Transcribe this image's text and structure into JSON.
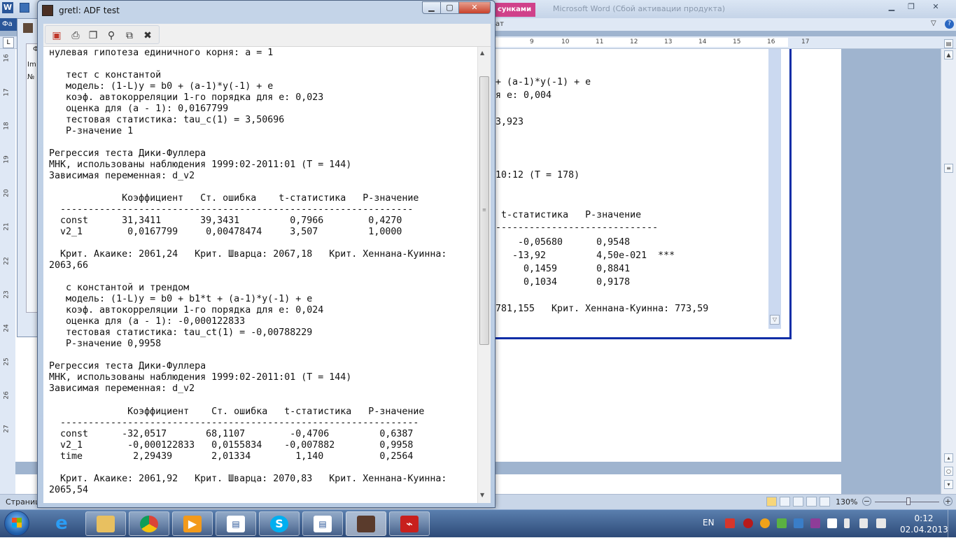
{
  "word": {
    "title_suffix": "Microsoft Word (Сбой активации продукта)",
    "pink_tab": "сунками",
    "file_tab": "Фа",
    "ribbon_label": "ат",
    "ruler_numbers": [
      "9",
      "10",
      "11",
      "12",
      "13",
      "14",
      "15",
      "16",
      "17"
    ],
    "vruler_numbers": [
      "16",
      "17",
      "18",
      "19",
      "20",
      "21",
      "22",
      "23",
      "24",
      "25",
      "26",
      "27"
    ],
    "embedded_lines": [
      "+ (a-1)*y(-1) + e",
      "я е: 0,004",
      "3,923",
      "10:12 (T = 178)",
      " t-статистика   P-значение",
      "-----------------------------",
      "    -0,05680      0,9548",
      "   -13,92         4,50e-021  ***",
      "     0,1459       0,8841",
      "     0,1034       0,9178",
      "781,155   Крит. Хеннана-Куинна: 773,59"
    ],
    "status_page": "Страниц",
    "zoom": "130%"
  },
  "behind": {
    "label1": "Фа",
    "label2": "Im",
    "label3": "№"
  },
  "gretl": {
    "title": "gretl: ADF test",
    "toolbar": {
      "save": "save-icon",
      "print": "print-icon",
      "copy": "copy-icon",
      "find": "find-icon",
      "windows": "windows-icon",
      "close": "close-icon"
    },
    "output": "нулевая гипотеза единичного корня: a = 1\n\n   тест с константой\n   модель: (1-L)y = b0 + (a-1)*y(-1) + e\n   коэф. автокорреляции 1-го порядка для е: 0,023\n   оценка для (a - 1): 0,0167799\n   тестовая статистика: tau_c(1) = 3,50696\n   P-значение 1\n\nРегрессия теста Дики-Фуллера\nМНК, использованы наблюдения 1999:02-2011:01 (T = 144)\nЗависимая переменная: d_v2\n\n             Коэффициент   Ст. ошибка    t-статистика   P-значение\n  ---------------------------------------------------------------\n  const      31,3411       39,3431         0,7966        0,4270\n  v2_1        0,0167799     0,00478474     3,507         1,0000\n\n  Крит. Акаике: 2061,24   Крит. Шварца: 2067,18   Крит. Хеннана-Куинна:\n2063,66\n\n   с константой и трендом\n   модель: (1-L)y = b0 + b1*t + (a-1)*y(-1) + e\n   коэф. автокорреляции 1-го порядка для е: 0,024\n   оценка для (a - 1): -0,000122833\n   тестовая статистика: tau_ct(1) = -0,00788229\n   P-значение 0,9958\n\nРегрессия теста Дики-Фуллера\nМНК, использованы наблюдения 1999:02-2011:01 (T = 144)\nЗависимая переменная: d_v2\n\n              Коэффициент    Ст. ошибка   t-статистика   P-значение\n  ----------------------------------------------------------------\n  const      -32,0517       68,1107        -0,4706         0,6387\n  v2_1        -0,000122833   0,0155834    -0,007882        0,9958\n  time         2,29439       2,01334        1,140          0,2564\n\n  Крит. Акаике: 2061,92   Крит. Шварца: 2070,83   Крит. Хеннана-Куинна:\n2065,54"
  },
  "taskbar": {
    "lang": "EN",
    "time": "0:12",
    "date": "02.04.2013",
    "apps": [
      "internet-explorer",
      "file-explorer",
      "chrome",
      "media-player",
      "word-document",
      "skype",
      "word-document-2",
      "gretl",
      "acrobat"
    ]
  },
  "colors": {
    "titlebar": "#c4d4e8",
    "close_red": "#c8412a",
    "taskbar": "#2d4a78",
    "embedded_border": "#0c2da7"
  }
}
